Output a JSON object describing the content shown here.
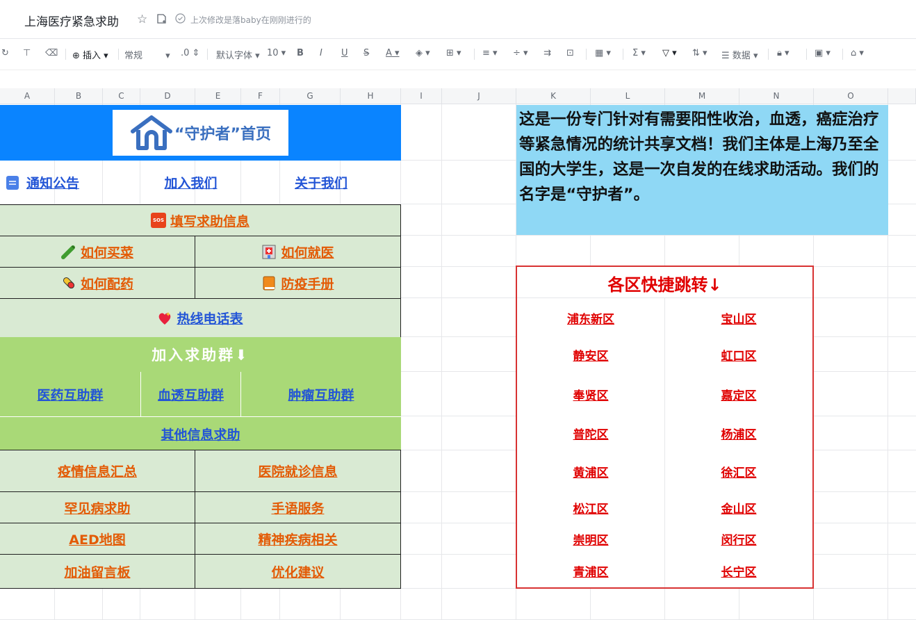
{
  "app": {
    "title": "上海医疗紧急求助",
    "last_edit": "上次修改是落baby在刚刚进行的"
  },
  "toolbar": {
    "insert": "插入",
    "format": "常规",
    "decimal": ".0",
    "font": "默认字体",
    "size": "10",
    "data": "数据"
  },
  "columns": [
    "A",
    "B",
    "C",
    "D",
    "E",
    "F",
    "G",
    "H",
    "I",
    "J",
    "K",
    "L",
    "M",
    "N",
    "O"
  ],
  "sheet": {
    "home_label": "“守护者”首页",
    "nav": {
      "notice": "通知公告",
      "join": "加入我们",
      "about": "关于我们"
    },
    "fill_help": "填写求助信息",
    "buy_food": "如何买菜",
    "see_doctor": "如何就医",
    "medicine": "如何配药",
    "manual": "防疫手册",
    "hotline": "热线电话表",
    "join_group": "加入求助群⬇",
    "groups": {
      "medicine": "医药互助群",
      "dialysis": "血透互助群",
      "tumor": "肿瘤互助群"
    },
    "other": "其他信息求助",
    "links": [
      [
        "疫情信息汇总",
        "医院就诊信息"
      ],
      [
        "罕见病求助",
        "手语服务"
      ],
      [
        "AED地图",
        "精神疾病相关"
      ],
      [
        "加油留言板",
        "优化建议"
      ]
    ],
    "intro": "这是一份专门针对有需要阳性收治，血透，癌症治疗等紧急情况的统计共享文档！我们主体是上海乃至全国的大学生，这是一次自发的在线求助活动。我们的名字是“守护者”。",
    "district_title": "各区快捷跳转↓",
    "districts": [
      [
        "浦东新区",
        "宝山区"
      ],
      [
        "静安区",
        "虹口区"
      ],
      [
        "奉贤区",
        "嘉定区"
      ],
      [
        "普陀区",
        "杨浦区"
      ],
      [
        "黄浦区",
        "徐汇区"
      ],
      [
        "松江区",
        "金山区"
      ],
      [
        "崇明区",
        "闵行区"
      ],
      [
        "青浦区",
        "长宁区"
      ]
    ]
  },
  "colors": {
    "blue_header": "#0a84ff",
    "light_green": "#d9ead3",
    "green": "#a9d977",
    "light_blue": "#8fd8f5",
    "link_blue": "#2355d6",
    "link_orange": "#e35b06",
    "link_red": "#e00000"
  }
}
